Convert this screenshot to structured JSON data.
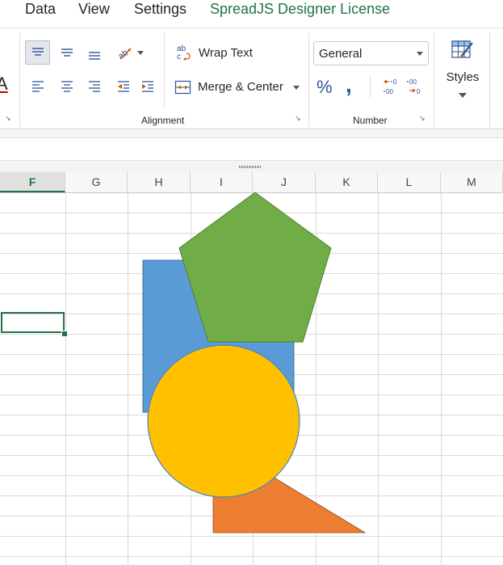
{
  "menu": {
    "items": [
      "Data",
      "View",
      "Settings"
    ],
    "license": "SpreadJS Designer License"
  },
  "ribbon": {
    "font_partial_glyph": "A",
    "alignment": {
      "label": "Alignment",
      "wrap_text": "Wrap Text",
      "merge_center": "Merge & Center"
    },
    "number": {
      "label": "Number",
      "format_value": "General",
      "percent_glyph": "%",
      "comma_glyph": ","
    },
    "styles": {
      "label": "Styles"
    }
  },
  "sheet": {
    "columns": [
      "F",
      "G",
      "H",
      "I",
      "J",
      "K",
      "L",
      "M"
    ],
    "selected_column": "F"
  },
  "shapes": {
    "rectangle_color": "#5b9bd5",
    "pentagon_color": "#70ad47",
    "circle_color": "#ffc000",
    "triangle_color": "#ed7d31"
  },
  "accent": "#217346"
}
